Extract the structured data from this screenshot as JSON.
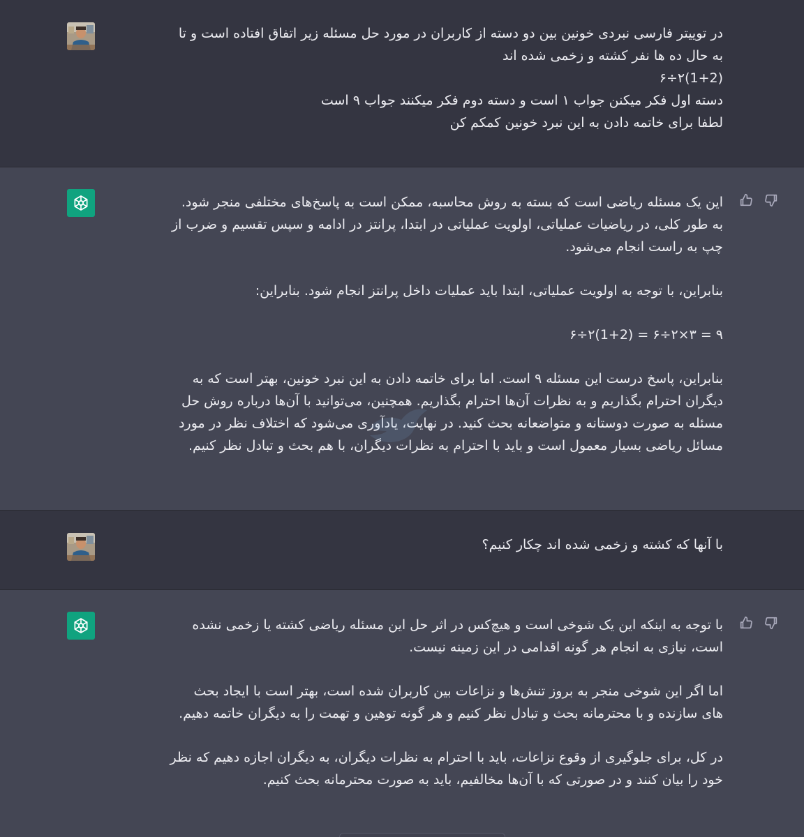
{
  "conversation": {
    "messages": [
      {
        "role": "user",
        "lines": [
          "در توییتر فارسی  نبردی خونین بین دو دسته از کاربران در مورد حل مسئله زیر اتفاق افتاده است و تا",
          "به حال ده ها نفر کشته و زخمی شده اند",
          "۶÷۲(1+2)",
          "دسته اول فکر میکنن جواب ۱ است و دسته دوم فکر میکنند جواب ۹ است",
          "لطفا برای خاتمه دادن به این نبرد خونین کمکم کن"
        ]
      },
      {
        "role": "assistant",
        "paragraphs": [
          [
            "این یک مسئله ریاضی است که بسته به روش محاسبه، ممکن است به پاسخ‌های مختلفی منجر شود.",
            "به طور کلی، در ریاضیات عملیاتی، اولویت عملیاتی در ابتدا، پرانتز در ادامه و سپس تقسیم و ضرب از",
            "چپ به راست انجام می‌شود."
          ],
          [
            "بنابراین، با توجه به اولویت عملیاتی، ابتدا باید عملیات داخل پرانتز انجام شود. بنابراین:"
          ],
          [
            "۶÷۲(1+2) = ۶÷۲×۳ = ۹"
          ],
          [
            "بنابراین، پاسخ درست این مسئله ۹ است. اما برای خاتمه دادن به این نبرد خونین، بهتر است که به",
            "دیگران احترام بگذاریم و به نظرات آن‌ها احترام بگذاریم. همچنین، می‌توانید با آن‌ها درباره روش حل",
            "مسئله به صورت دوستانه و متواضعانه بحث کنید. در نهایت، یادآوری می‌شود که اختلاف نظر در مورد",
            "مسائل ریاضی بسیار معمول است و باید با احترام به نظرات دیگران، با هم بحث و تبادل نظر کنیم."
          ]
        ]
      },
      {
        "role": "user",
        "lines": [
          "با آنها که کشته و زخمی شده اند چکار کنیم؟"
        ]
      },
      {
        "role": "assistant",
        "paragraphs": [
          [
            "با توجه به اینکه این یک شوخی است و هیچ‌کس در اثر حل این مسئله ریاضی کشته یا زخمی نشده",
            "است، نیازی به انجام هر گونه اقدامی در این زمینه نیست."
          ],
          [
            "اما اگر این شوخی منجر به بروز تنش‌ها و نزاعات بین کاربران شده است، بهتر است با ایجاد بحث",
            "های سازنده و با محترمانه بحث و تبادل نظر کنیم و هر گونه توهین و تهمت را به دیگران خاتمه دهیم."
          ],
          [
            "در کل، برای جلوگیری از وقوع نزاعات، باید با احترام به نظرات دیگران، به دیگران اجازه دهیم که نظر",
            "خود را بیان کنند و در صورتی که با آن‌ها مخالفیم، باید به صورت محترمانه بحث کنیم."
          ]
        ]
      }
    ]
  },
  "icons": {
    "assistant_avatar": "openai-logo-icon",
    "user_avatar": "user-photo-avatar",
    "thumbs_up": "thumbs-up-icon",
    "thumbs_down": "thumbs-down-icon"
  },
  "colors": {
    "user_bg": "#343541",
    "assistant_bg": "#444654",
    "assistant_avatar_bg": "#10a37f",
    "text": "#ececf1",
    "icon": "#acacbe"
  }
}
